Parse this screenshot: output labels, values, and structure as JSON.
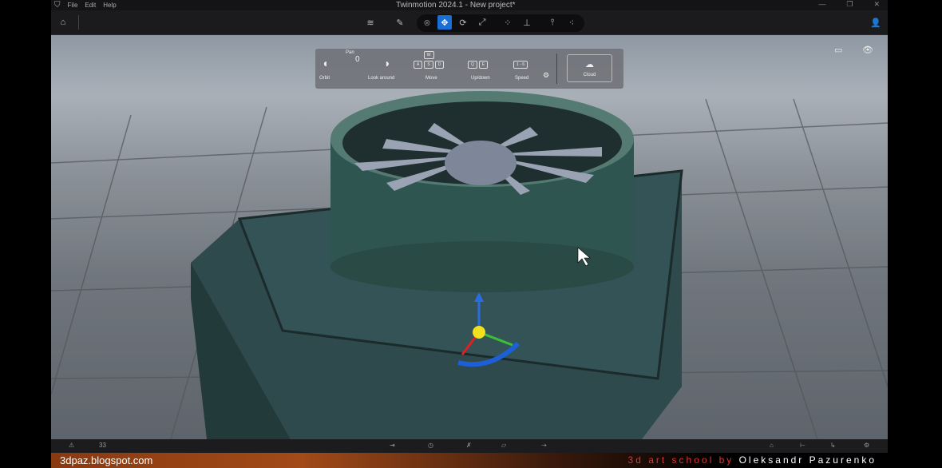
{
  "titlebar": {
    "menu": [
      "File",
      "Edit",
      "Help"
    ],
    "title": "Twinmotion 2024.1 - New project*",
    "window_controls": [
      "—",
      "❐",
      "✕"
    ]
  },
  "toolbar": {
    "icons": [
      "home-icon",
      "layers-icon",
      "eyedropper-icon",
      "close-icon",
      "move-icon",
      "rotate-icon",
      "scale-icon",
      "snap-icon",
      "drop-to-floor-icon",
      "pivot-icon",
      "multi-select-icon",
      "user-icon"
    ]
  },
  "navigation_help": {
    "orbit": "Orbit",
    "pan": "Pan",
    "look_around": "Look around",
    "move": "Move",
    "move_keys": [
      "W",
      "A",
      "S",
      "D"
    ],
    "updown": "Up/down",
    "updown_keys": [
      "Q",
      "E"
    ],
    "speed": "Speed",
    "speed_keys": "1 - 6",
    "cloud": "Cloud"
  },
  "bottombar": {
    "value": "33"
  },
  "banner": {
    "site": "3dpaz.blogspot.com",
    "credit_prefix": "3d art school by ",
    "credit_name": "Oleksandr Pazurenko"
  }
}
